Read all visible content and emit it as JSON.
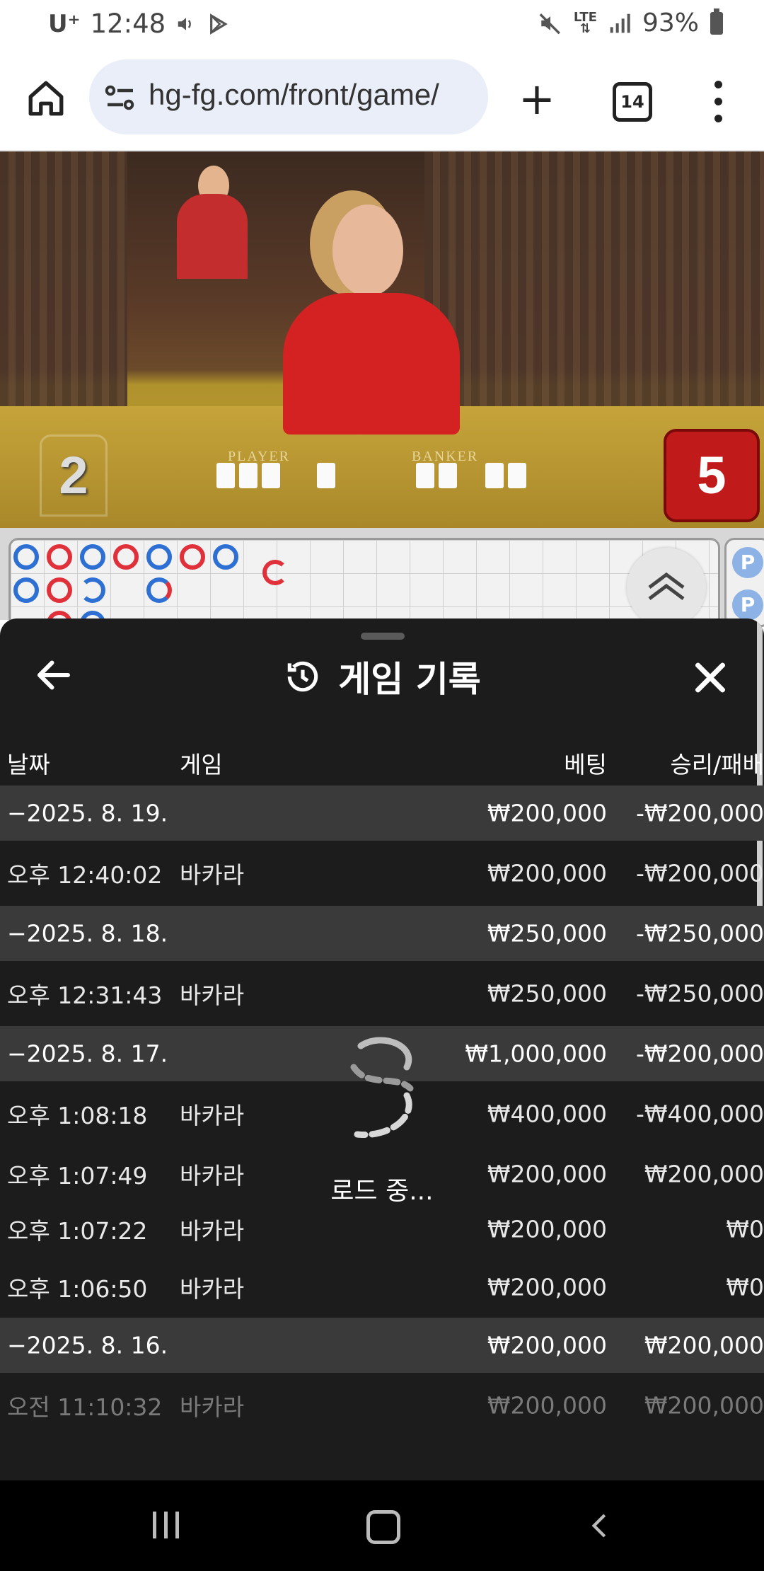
{
  "status_bar": {
    "carrier": "U⁺",
    "time": "12:48",
    "network": "LTE",
    "battery": "93%"
  },
  "browser": {
    "url": "hg-fg.com/front/game/",
    "tab_count": "14"
  },
  "video": {
    "player_label": "PLAYER",
    "banker_label": "BANKER",
    "player_score": "2",
    "banker_score": "5"
  },
  "roadmap": {
    "side_labels": [
      "P",
      "P"
    ]
  },
  "history": {
    "title": "게임 기록",
    "columns": {
      "date": "날짜",
      "game": "게임",
      "bet": "베팅",
      "result": "승리/패배"
    },
    "rows": [
      {
        "type": "group",
        "date": "−2025. 8. 19.",
        "bet": "₩200,000",
        "result": "-₩200,000"
      },
      {
        "type": "item",
        "time": "오후 12:40:02",
        "game": "바카라",
        "bet": "₩200,000",
        "result": "-₩200,000"
      },
      {
        "type": "group",
        "date": "−2025. 8. 18.",
        "bet": "₩250,000",
        "result": "-₩250,000"
      },
      {
        "type": "item",
        "time": "오후 12:31:43",
        "game": "바카라",
        "bet": "₩250,000",
        "result": "-₩250,000"
      },
      {
        "type": "group",
        "date": "−2025. 8. 17.",
        "bet": "₩1,000,000",
        "result": "-₩200,000"
      },
      {
        "type": "item",
        "time": "오후 1:08:18",
        "game": "바카라",
        "bet": "₩400,000",
        "result": "-₩400,000"
      },
      {
        "type": "item",
        "time": "오후 1:07:49",
        "game": "바카라",
        "bet": "₩200,000",
        "result": "₩200,000"
      },
      {
        "type": "item",
        "time": "오후 1:07:22",
        "game": "바카라",
        "bet": "₩200,000",
        "result": "₩0"
      },
      {
        "type": "item",
        "time": "오후 1:06:50",
        "game": "바카라",
        "bet": "₩200,000",
        "result": "₩0"
      },
      {
        "type": "group",
        "date": "−2025. 8. 16.",
        "bet": "₩200,000",
        "result": "₩200,000"
      },
      {
        "type": "item",
        "time": "오전 11:10:32",
        "game": "바카라",
        "bet": "₩200,000",
        "result": "₩200,000"
      }
    ],
    "loading_text": "로드 중..."
  },
  "colors": {
    "banker_ring": "#e0303a",
    "player_ring": "#2d6fd2",
    "sheet_bg": "#1c1c1c",
    "group_row_bg": "#3a3a3a"
  }
}
